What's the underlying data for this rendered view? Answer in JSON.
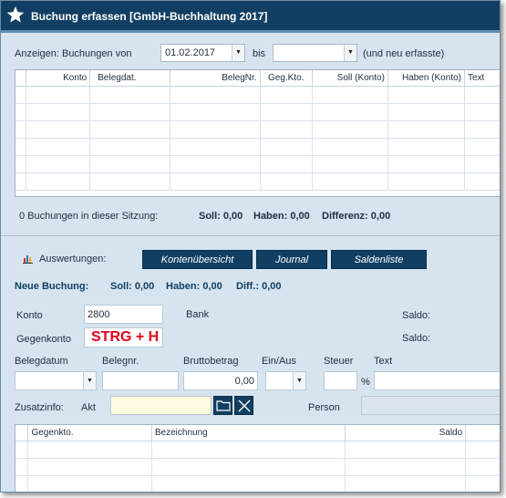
{
  "window": {
    "title": "Buchung erfassen [GmbH-Buchhaltung 2017]"
  },
  "filter": {
    "label": "Anzeigen: Buchungen von",
    "from_value": "01.02.2017",
    "bis_label": "bis",
    "to_value": "",
    "suffix": "(und neu erfasste)"
  },
  "bookings_table": {
    "columns": [
      "Konto",
      "Belegdat.",
      "BelegNr.",
      "Geg.Kto.",
      "Soll (Konto)",
      "Haben (Konto)",
      "Text"
    ]
  },
  "session": {
    "count_text": "0 Buchungen in dieser Sitzung:",
    "soll": "Soll: 0,00",
    "haben": "Haben: 0,00",
    "differenz": "Differenz: 0,00"
  },
  "auswertungen": {
    "label": "Auswertungen:",
    "buttons": [
      "Kontenübersicht",
      "Journal",
      "Saldenliste"
    ]
  },
  "neue_buchung": {
    "label": "Neue Buchung:",
    "soll": "Soll: 0,00",
    "haben": "Haben: 0,00",
    "diff": "Diff.: 0,00"
  },
  "form": {
    "konto_label": "Konto",
    "konto_value": "2800",
    "konto_name": "Bank",
    "saldo_label": "Saldo:",
    "gegenkonto_label": "Gegenkonto",
    "gegenkonto_overlay": "STRG + H",
    "gegen_saldo_label": "Saldo:",
    "belegdatum_label": "Belegdatum",
    "belegnr_label": "Belegnr.",
    "brutto_label": "Bruttobetrag",
    "brutto_value": "0,00",
    "einaus_label": "Ein/Aus",
    "steuer_label": "Steuer",
    "percent": "%",
    "text_label": "Text",
    "zusatz_label": "Zusatzinfo:",
    "akt_label": "Akt",
    "person_label": "Person"
  },
  "lower_table": {
    "columns": [
      "Gegenkto.",
      "Bezeichnung",
      "Saldo"
    ]
  },
  "colors": {
    "titlebar": "#113f63",
    "panel": "#d6e4ef",
    "accent_red": "#e0001b",
    "link_blue": "#113f63"
  }
}
